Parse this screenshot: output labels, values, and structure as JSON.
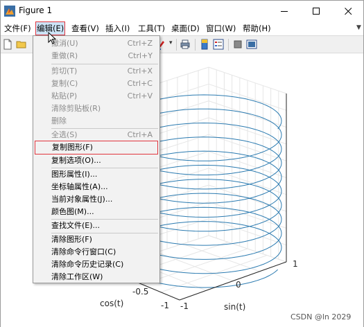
{
  "window": {
    "title": "Figure 1"
  },
  "menubar": {
    "items": [
      {
        "label": "文件(F)"
      },
      {
        "label": "编辑(E)"
      },
      {
        "label": "查看(V)"
      },
      {
        "label": "插入(I)"
      },
      {
        "label": "工具(T)"
      },
      {
        "label": "桌面(D)"
      },
      {
        "label": "窗口(W)"
      },
      {
        "label": "帮助(H)"
      }
    ]
  },
  "edit_menu": {
    "undo": {
      "label": "撤消(U)",
      "shortcut": "Ctrl+Z"
    },
    "redo": {
      "label": "重做(R)",
      "shortcut": "Ctrl+Y"
    },
    "cut": {
      "label": "剪切(T)",
      "shortcut": "Ctrl+X"
    },
    "copy": {
      "label": "复制(C)",
      "shortcut": "Ctrl+C"
    },
    "paste": {
      "label": "粘贴(P)",
      "shortcut": "Ctrl+V"
    },
    "clear_clipboard": {
      "label": "清除剪贴板(R)"
    },
    "delete": {
      "label": "删除"
    },
    "select_all": {
      "label": "全选(S)",
      "shortcut": "Ctrl+A"
    },
    "copy_figure": {
      "label": "复制图形(F)"
    },
    "copy_options": {
      "label": "复制选项(O)..."
    },
    "figure_properties": {
      "label": "图形属性(I)..."
    },
    "axes_properties": {
      "label": "坐标轴属性(A)..."
    },
    "object_properties": {
      "label": "当前对象属性(J)..."
    },
    "colormap": {
      "label": "颜色图(M)..."
    },
    "find_files": {
      "label": "查找文件(E)..."
    },
    "clear_figure": {
      "label": "清除图形(F)"
    },
    "clear_command_window": {
      "label": "清除命令行窗口(C)"
    },
    "clear_command_history": {
      "label": "清除命令历史记录(C)"
    },
    "clear_workspace": {
      "label": "清除工作区(W)"
    }
  },
  "plot": {
    "line_color": "#2a7ab0",
    "xlabel": "cos(t)",
    "ylabel": "sin(t)",
    "x_ticks": [
      "-1",
      "-0.5"
    ],
    "y_ticks": [
      "-1",
      "0",
      "1"
    ]
  },
  "watermark": "CSDN @ln 2029"
}
